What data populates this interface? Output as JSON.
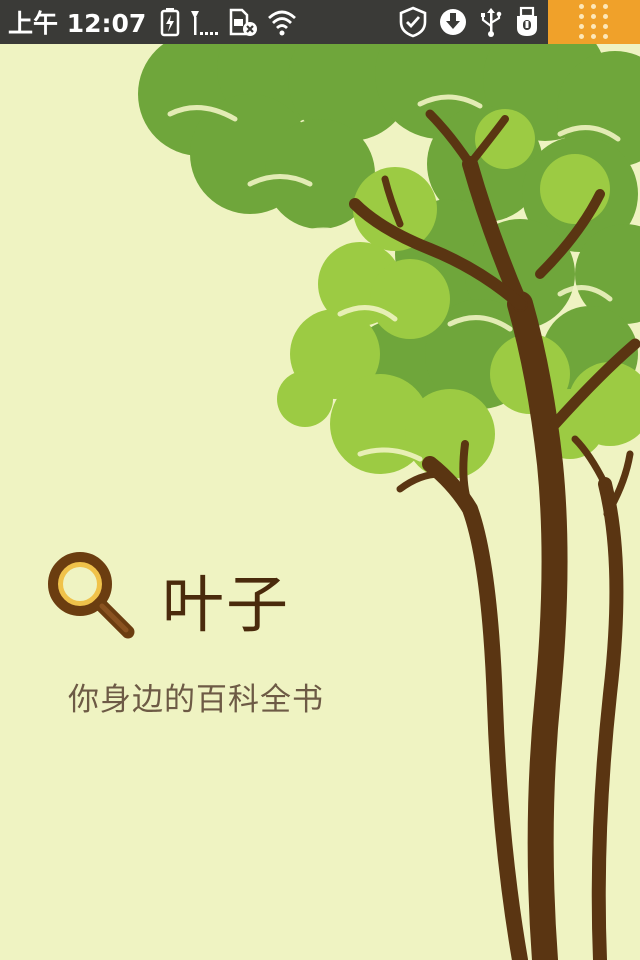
{
  "status_bar": {
    "time": "上午 12:07",
    "left_icons": [
      "battery-charging-icon",
      "signal-icon",
      "sim-card-disabled-icon",
      "wifi-icon"
    ],
    "right_icons": [
      "shield-check-icon",
      "download-icon",
      "usb-icon",
      "usb-debugging-icon"
    ],
    "notification_corner_icon": "app-grid-icon",
    "accent_color": "#f0a12a"
  },
  "splash": {
    "app_name": "叶子",
    "slogan": "你身边的百科全书",
    "logo_icon": "magnifier-icon"
  },
  "colors": {
    "background": "#eff3c2",
    "leaf_dark": "#6fa63b",
    "leaf_light": "#9ccb43",
    "trunk": "#5a3512",
    "text_dark": "#4a2a0c",
    "text_muted": "#6d5a45"
  }
}
